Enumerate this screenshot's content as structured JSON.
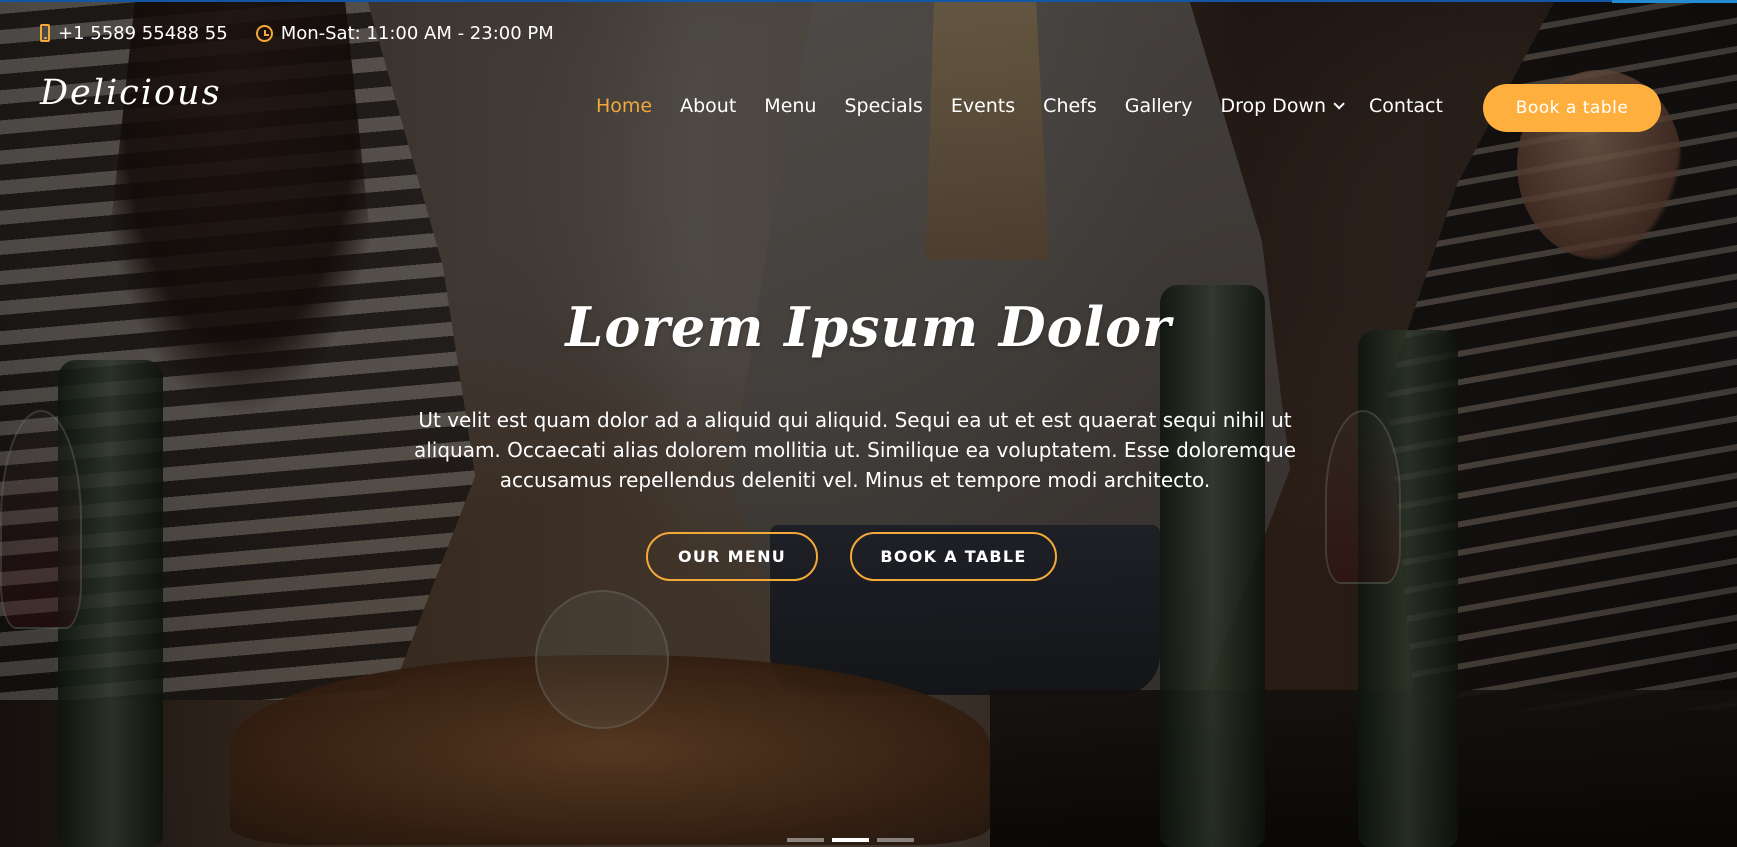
{
  "topbar": {
    "phone": "+1 5589 55488 55",
    "hours": "Mon-Sat: 11:00 AM - 23:00 PM"
  },
  "brand": {
    "logo": "Delicious"
  },
  "navigation": {
    "items": [
      {
        "label": "Home",
        "active": true
      },
      {
        "label": "About"
      },
      {
        "label": "Menu"
      },
      {
        "label": "Specials"
      },
      {
        "label": "Events"
      },
      {
        "label": "Chefs"
      },
      {
        "label": "Gallery"
      },
      {
        "label": "Drop Down",
        "dropdown_icon": "chevron-down-icon"
      },
      {
        "label": "Contact"
      }
    ],
    "book_button": "Book a table"
  },
  "hero": {
    "title": "Lorem Ipsum Dolor",
    "description": "Ut velit est quam dolor ad a aliquid qui aliquid. Sequi ea ut et est quaerat sequi nihil ut aliquam. Occaecati alias dolorem mollitia ut. Similique ea voluptatem. Esse doloremque accusamus repellendus deleniti vel. Minus et tempore modi architecto.",
    "buttons": {
      "menu": "OUR MENU",
      "book": "BOOK A TABLE"
    },
    "slider": {
      "active_index": 1
    }
  },
  "colors": {
    "accent": "#ffaf3d",
    "accent_outline": "#f3a83a",
    "progress_bar": "#1256a6"
  }
}
